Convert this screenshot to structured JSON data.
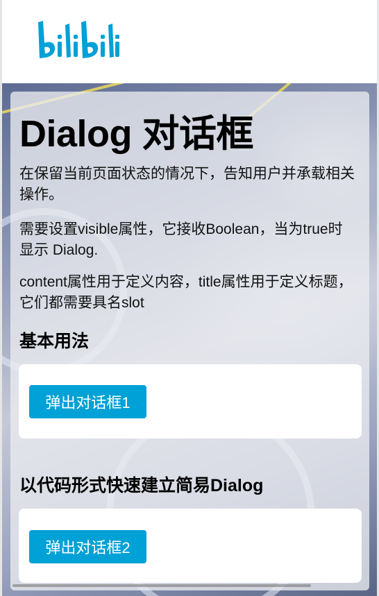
{
  "header": {
    "logo_text": "bilibili"
  },
  "page": {
    "title": "Dialog 对话框",
    "paragraphs": [
      "在保留当前页面状态的情况下，告知用户并承载相关操作。",
      "需要设置visible属性，它接收Boolean，当为true时显示 Dialog.",
      "content属性用于定义内容，title属性用于定义标题，它们都需要具名slot"
    ]
  },
  "sections": [
    {
      "title": "基本用法",
      "button_label": "弹出对话框1"
    },
    {
      "title": "以代码形式快速建立简易Dialog",
      "button_label": "弹出对话框2"
    }
  ],
  "colors": {
    "brand": "#00a1d6",
    "logo": "#00a1d6"
  }
}
